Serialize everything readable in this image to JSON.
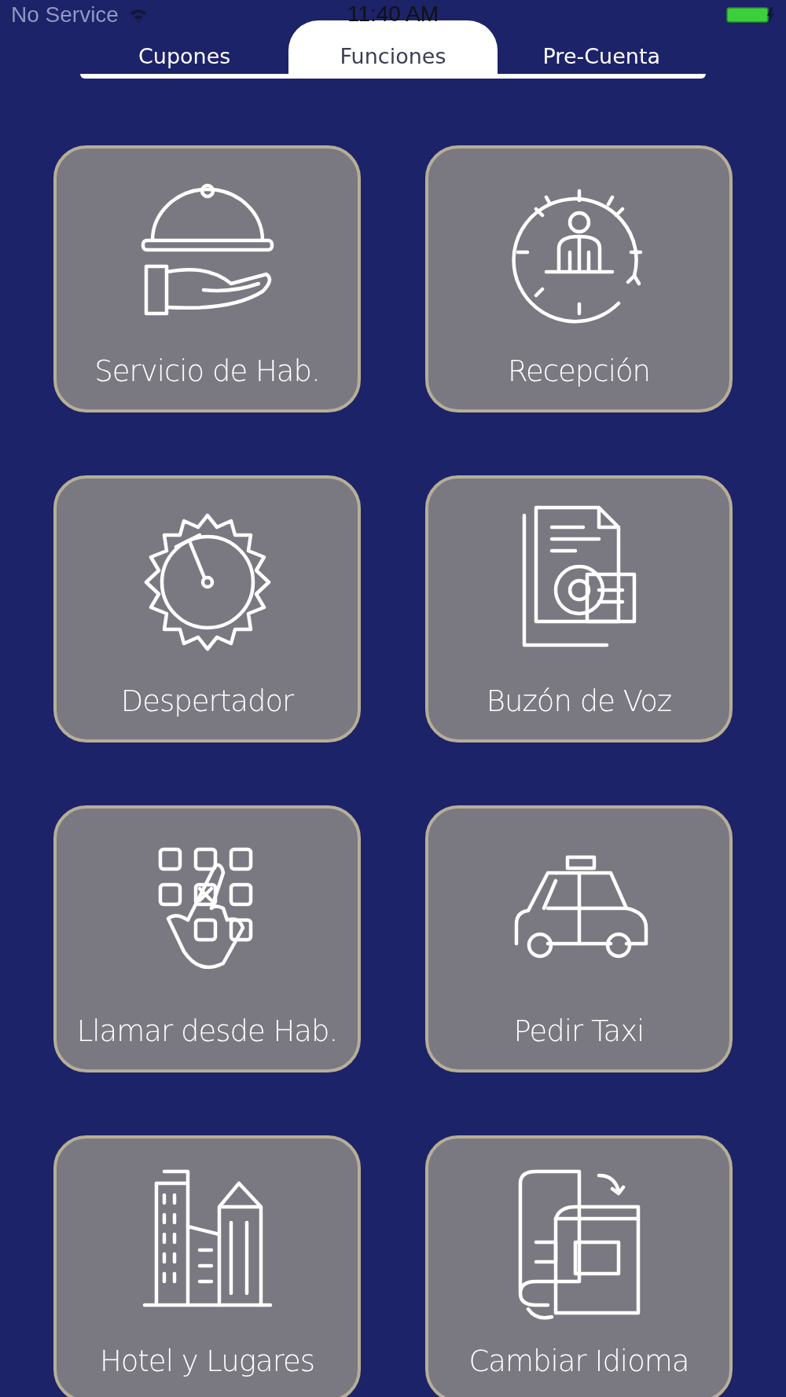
{
  "status_bar": {
    "carrier": "No Service",
    "time": "11:40 AM"
  },
  "tabs": [
    {
      "label": "Cupones",
      "selected": false
    },
    {
      "label": "Funciones",
      "selected": true
    },
    {
      "label": "Pre-Cuenta",
      "selected": false
    }
  ],
  "tiles": [
    {
      "label": "Servicio de Hab."
    },
    {
      "label": "Recepción"
    },
    {
      "label": "Despertador"
    },
    {
      "label": "Buzón de Voz"
    },
    {
      "label": "Llamar desde Hab."
    },
    {
      "label": "Pedir Taxi"
    },
    {
      "label": "Hotel y Lugares"
    },
    {
      "label": "Cambiar Idioma"
    }
  ]
}
